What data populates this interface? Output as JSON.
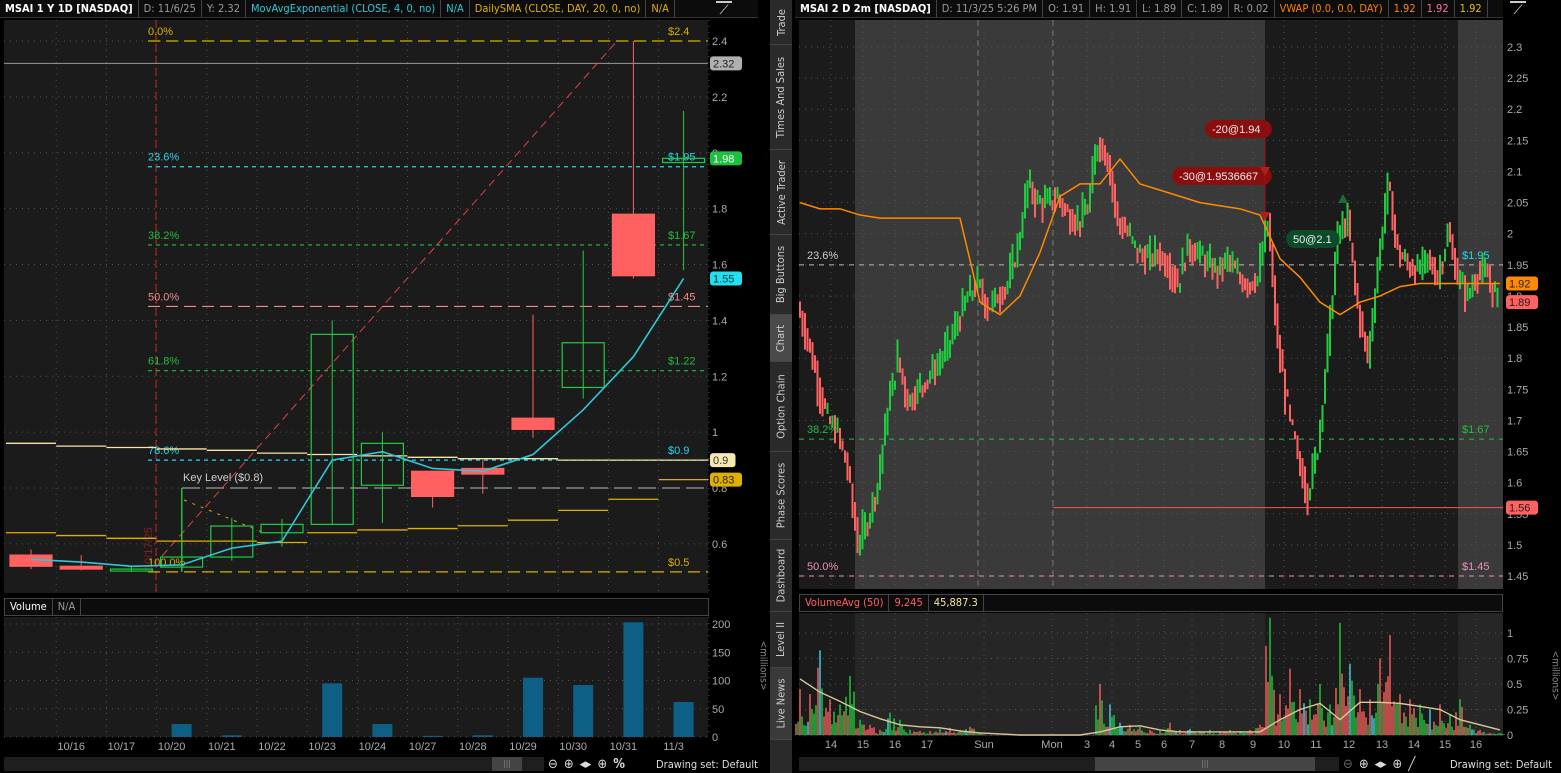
{
  "left_header": {
    "symbol": "MSAI 1 Y 1D [NASDAQ]",
    "date": "D: 11/6/25",
    "y_value": "Y: 2.32",
    "ema_label": "MovAvgExponential (CLOSE, 4, 0, no)",
    "ema_value": "N/A",
    "sma_label": "DailySMA (CLOSE, DAY, 20, 0, no)",
    "sma_value": "N/A"
  },
  "right_header": {
    "symbol": "MSAI 2 D 2m [NASDAQ]",
    "date": "D: 11/3/25 5:26 PM",
    "open": "O: 1.91",
    "high": "H: 1.91",
    "low": "L: 1.89",
    "close": "C: 1.89",
    "range": "R: 0.02",
    "vwap_label": "VWAP (0.0, 0.0, DAY)",
    "vwap_values": [
      "1.92",
      "1.92",
      "1.92"
    ]
  },
  "colors": {
    "up": "#1fcc3f",
    "down": "#ff6060",
    "ema": "#2fc8d8",
    "sma_upper": "#f3e6a6",
    "sma_lower": "#e0b000",
    "vwap": "#ff8a00",
    "volume_left": "#0d5f86"
  },
  "left_chart": {
    "y_ticks": [
      "2.4",
      "2.2",
      "2",
      "1.8",
      "1.6",
      "1.4",
      "1.2",
      "1",
      "0.8",
      "0.6"
    ],
    "x_labels": [
      "10/16",
      "10/17",
      "10/20",
      "10/21",
      "10/22",
      "10/23",
      "10/24",
      "10/27",
      "10/28",
      "10/29",
      "10/30",
      "10/31",
      "11/3"
    ],
    "candles": [
      {
        "o": 0.56,
        "h": 0.58,
        "l": 0.51,
        "c": 0.52
      },
      {
        "o": 0.52,
        "h": 0.56,
        "l": 0.505,
        "c": 0.51
      },
      {
        "o": 0.505,
        "h": 0.52,
        "l": 0.5,
        "c": 0.51
      },
      {
        "o": 0.517,
        "h": 0.8,
        "l": 0.5,
        "c": 0.553
      },
      {
        "o": 0.553,
        "h": 0.693,
        "l": 0.54,
        "c": 0.664
      },
      {
        "o": 0.64,
        "h": 0.69,
        "l": 0.59,
        "c": 0.67
      },
      {
        "o": 0.67,
        "h": 1.4,
        "l": 0.67,
        "c": 1.35
      },
      {
        "o": 0.81,
        "h": 1.0,
        "l": 0.675,
        "c": 0.96
      },
      {
        "o": 0.86,
        "h": 0.86,
        "l": 0.73,
        "c": 0.77
      },
      {
        "o": 0.87,
        "h": 0.9,
        "l": 0.78,
        "c": 0.85
      },
      {
        "o": 1.05,
        "h": 1.42,
        "l": 0.98,
        "c": 1.01
      },
      {
        "o": 1.16,
        "h": 1.65,
        "l": 1.12,
        "c": 1.32
      },
      {
        "o": 1.78,
        "h": 2.4,
        "l": 1.55,
        "c": 1.56
      },
      {
        "o": 1.965,
        "h": 2.15,
        "l": 1.58,
        "c": 1.98
      }
    ],
    "ema": [
      0.545,
      0.535,
      0.52,
      0.525,
      0.585,
      0.61,
      0.9,
      0.93,
      0.87,
      0.86,
      0.92,
      1.08,
      1.27,
      1.55
    ],
    "sma_upper": [
      0.96,
      0.95,
      0.945,
      0.94,
      0.935,
      0.925,
      0.92,
      0.915,
      0.91,
      0.905,
      0.905,
      0.9,
      0.9,
      0.9
    ],
    "sma_lower": [
      0.64,
      0.63,
      0.62,
      0.61,
      0.61,
      0.605,
      0.64,
      0.65,
      0.655,
      0.665,
      0.685,
      0.72,
      0.76,
      0.83
    ],
    "fib_levels": [
      {
        "pct": "0.0%",
        "price": "$2.4",
        "value": 2.4,
        "color": "#d9b000"
      },
      {
        "pct": "23.6%",
        "price": "$1.95",
        "value": 1.95,
        "color": "#22d8f0"
      },
      {
        "pct": "38.2%",
        "price": "$1.67",
        "value": 1.67,
        "color": "#1fbf3f"
      },
      {
        "pct": "50.0%",
        "price": "$1.45",
        "value": 1.45,
        "color": "#f28a8a"
      },
      {
        "pct": "61.8%",
        "price": "$1.22",
        "value": 1.22,
        "color": "#1fbf3f"
      },
      {
        "pct": "78.6%",
        "price": "$0.9",
        "value": 0.9,
        "color": "#22d8f0"
      },
      {
        "pct": "100.0%",
        "price": "$0.5",
        "value": 0.5,
        "color": "#d9b000"
      }
    ],
    "key_level": {
      "label": "Key Level ($0.8)",
      "value": 0.8
    },
    "vertical_marker": "10/17/25",
    "last_price_line": 2.32,
    "axis_bubbles": [
      {
        "text": "2.32",
        "value": 2.32,
        "bg": "#b0b0b0",
        "fg": "#222"
      },
      {
        "text": "1.98",
        "value": 1.98,
        "bg": "#1fbf3f",
        "fg": "#fff"
      },
      {
        "text": "1.55",
        "value": 1.55,
        "bg": "#22e0f0",
        "fg": "#033"
      },
      {
        "text": "0.9",
        "value": 0.9,
        "bg": "#f5e9b0",
        "fg": "#333"
      },
      {
        "text": "0.83",
        "value": 0.83,
        "bg": "#e0b000",
        "fg": "#222"
      }
    ]
  },
  "left_volume": {
    "title": "Volume",
    "value": "N/A",
    "unit_label": "<millions>",
    "y_ticks": [
      "200",
      "150",
      "100",
      "50",
      "0"
    ],
    "values": [
      0,
      0,
      0,
      23,
      3,
      0,
      95,
      23,
      2,
      3,
      105,
      92,
      203,
      62
    ]
  },
  "right_chart": {
    "y_ticks": [
      "2.3",
      "2.25",
      "2.2",
      "2.15",
      "2.1",
      "2.05",
      "2",
      "1.95",
      "1.9",
      "1.85",
      "1.8",
      "1.75",
      "1.7",
      "1.65",
      "1.6",
      "1.55",
      "1.5",
      "1.45"
    ],
    "x_labels": [
      "14",
      "15",
      "16",
      "17",
      "Sun",
      "Mon",
      "3",
      "4",
      "5",
      "6",
      "7",
      "8",
      "9",
      "10",
      "11",
      "12",
      "13",
      "14",
      "15",
      "16"
    ],
    "price_path": [
      1.88,
      1.83,
      1.76,
      1.7,
      1.68,
      1.62,
      1.5,
      1.54,
      1.6,
      1.72,
      1.8,
      1.73,
      1.75,
      1.77,
      1.79,
      1.82,
      1.86,
      1.9,
      1.92,
      1.88,
      1.9,
      1.92,
      1.98,
      2.08,
      2.05,
      2.05,
      2.06,
      2.03,
      2.02,
      2.04,
      2.15,
      2.12,
      2.02,
      2.0,
      1.97,
      1.96,
      1.97,
      1.95,
      1.92,
      1.98,
      1.97,
      1.95,
      1.94,
      1.96,
      1.93,
      1.92,
      1.93,
      2.02,
      1.82,
      1.72,
      1.64,
      1.58,
      1.66,
      1.82,
      2.0,
      2.02,
      1.88,
      1.8,
      1.95,
      2.08,
      1.97,
      1.95,
      1.94,
      1.96,
      1.93,
      2.0,
      1.93,
      1.9,
      1.94,
      1.93,
      1.89
    ],
    "vwap": [
      2.05,
      2.04,
      2.04,
      2.03,
      2.025,
      2.025,
      2.025,
      2.025,
      2.025,
      1.89,
      1.87,
      1.9,
      1.97,
      2.06,
      2.08,
      2.08,
      2.12,
      2.08,
      2.07,
      2.06,
      2.05,
      2.045,
      2.04,
      2.03,
      1.96,
      1.93,
      1.89,
      1.87,
      1.89,
      1.9,
      1.915,
      1.92,
      1.92,
      1.92,
      1.92,
      1.92
    ],
    "levels": [
      {
        "pct": "23.6%",
        "price": "$1.95",
        "value": 1.95,
        "color": "#22d8f0"
      },
      {
        "pct": "38.2%",
        "price": "$1.67",
        "value": 1.67,
        "color": "#1fbf3f"
      },
      {
        "pct": "50.0%",
        "price": "$1.45",
        "value": 1.45,
        "color": "#e890c0"
      }
    ],
    "red_level": 1.56,
    "orders": [
      {
        "text": "-20@1.94",
        "type": "sell"
      },
      {
        "text": "-30@1.9536667",
        "type": "sell"
      },
      {
        "text": "50@2.1",
        "type": "buy"
      }
    ],
    "axis_bubbles": [
      {
        "text": "1.92",
        "value": 1.92,
        "bg": "#ff8a00",
        "fg": "#222"
      },
      {
        "text": "1.89",
        "value": 1.89,
        "bg": "#ff6060",
        "fg": "#222"
      },
      {
        "text": "1.56",
        "value": 1.56,
        "bg": "#ff6060",
        "fg": "#222"
      }
    ]
  },
  "right_volume": {
    "title": "VolumeAvg (50)",
    "value1": "9,245",
    "value2": "45,887.3",
    "unit_label": "<millions>",
    "y_ticks": [
      "1",
      "0.75",
      "0.5",
      "0.25",
      "0"
    ],
    "values": [
      0.45,
      0.4,
      0.83,
      0.35,
      0.3,
      0.58,
      0.15,
      0.1,
      0.05,
      0.22,
      0.15,
      0.05,
      0.04,
      0.04,
      0.06,
      0.07,
      0.05,
      0.08,
      0.02,
      0,
      0,
      0,
      0,
      0,
      0,
      0,
      0,
      0,
      0,
      0,
      0.5,
      0.3,
      0.12,
      0.1,
      0.08,
      0.05,
      0.04,
      0.12,
      0.05,
      0.06,
      0.04,
      0.05,
      0.04,
      0.05,
      0.04,
      0.05,
      0.1,
      1.15,
      0.4,
      0.65,
      0.45,
      0.35,
      0.5,
      0.3,
      1.1,
      0.7,
      0.45,
      0.35,
      0.75,
      0.98,
      0.4,
      0.35,
      0.3,
      0.25,
      0.3,
      0.2,
      0.35,
      0.1,
      0.05,
      0.02,
      0.02
    ],
    "avg": [
      0.55,
      0.42,
      0.33,
      0.23,
      0.16,
      0.1,
      0.08,
      0.07,
      0.04,
      0.02,
      0.01,
      0,
      0,
      0,
      0,
      0.03,
      0.08,
      0.09,
      0.05,
      0.03,
      0.03,
      0.03,
      0.03,
      0.03,
      0.15,
      0.25,
      0.31,
      0.15,
      0.32,
      0.32,
      0.31,
      0.28,
      0.25,
      0.15,
      0.1,
      0.05
    ]
  },
  "sidebar_tabs": [
    "Trade",
    "Times And Sales",
    "Active Trader",
    "Big Buttons",
    "Chart",
    "Option Chain",
    "Phase Scores",
    "Dashboard",
    "Level II",
    "Live News"
  ],
  "bottom": {
    "drawing_set": "Drawing set: Default",
    "percent": "%"
  }
}
